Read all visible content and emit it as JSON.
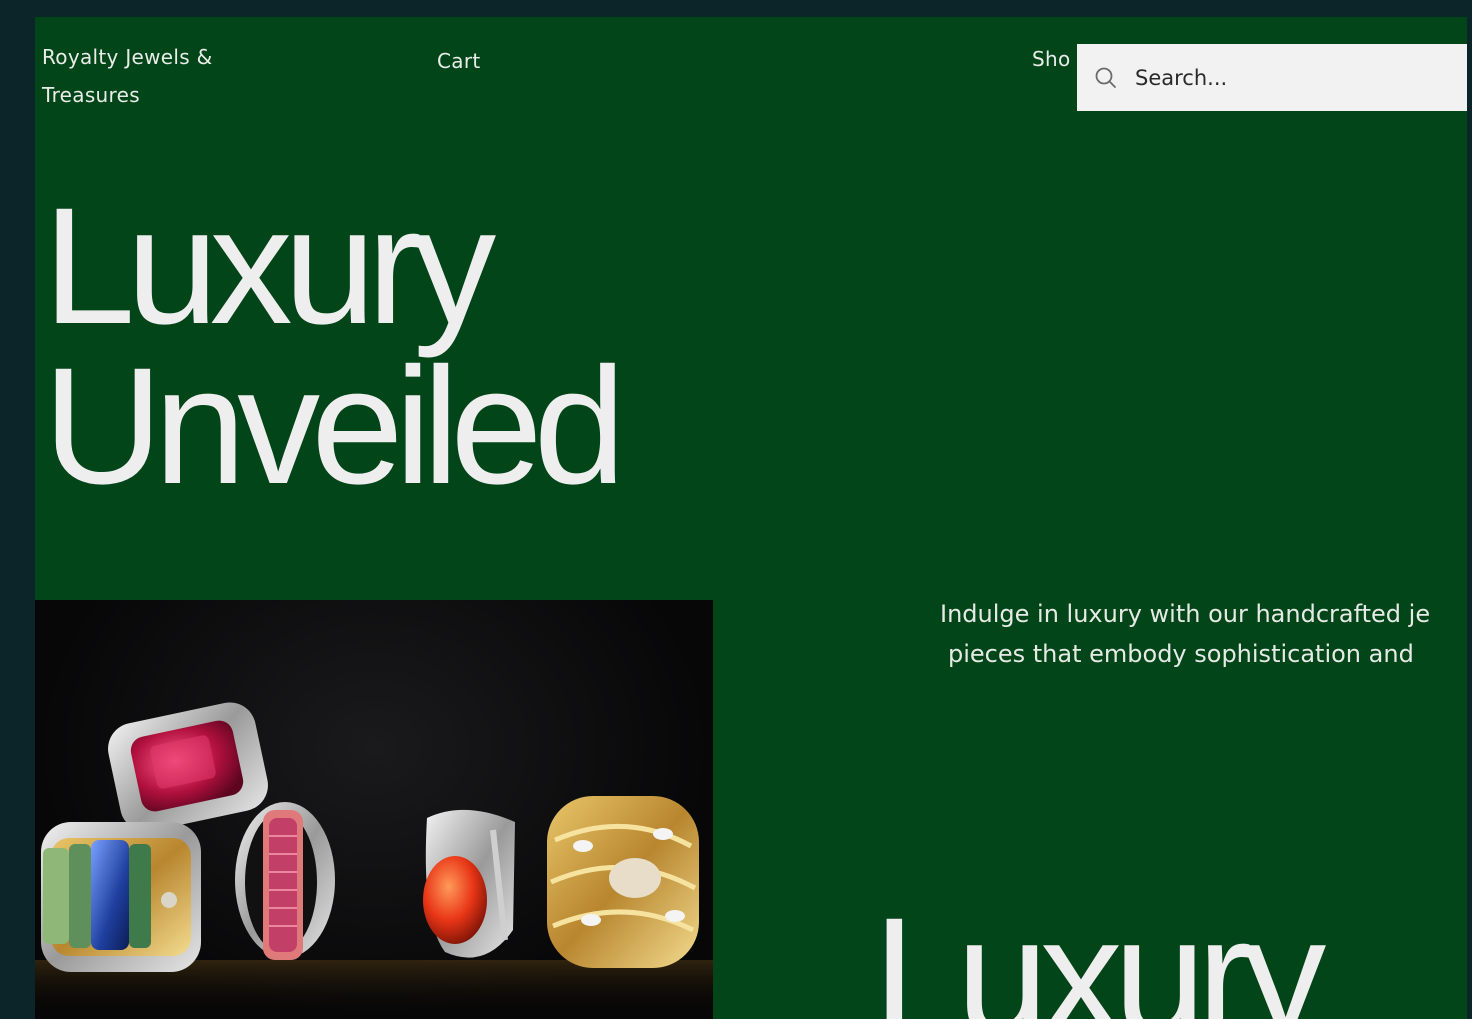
{
  "header": {
    "brand": "Royalty Jewels & Treasures",
    "nav": {
      "cart_label": "Cart",
      "shop_label": "Sho"
    },
    "search": {
      "placeholder": "Search..."
    }
  },
  "hero": {
    "title_line_1": "Luxury",
    "title_line_2": "Unveiled",
    "intro_line_1": "Indulge in luxury with our handcrafted je",
    "intro_line_2": "pieces that embody sophistication and",
    "secondary_title": "Luxury"
  },
  "colors": {
    "page_background": "#0c2529",
    "panel_green": "#024518",
    "text_light": "#eeeeee",
    "search_background": "#f1f2f1"
  },
  "icons": {
    "search": "search-icon"
  }
}
